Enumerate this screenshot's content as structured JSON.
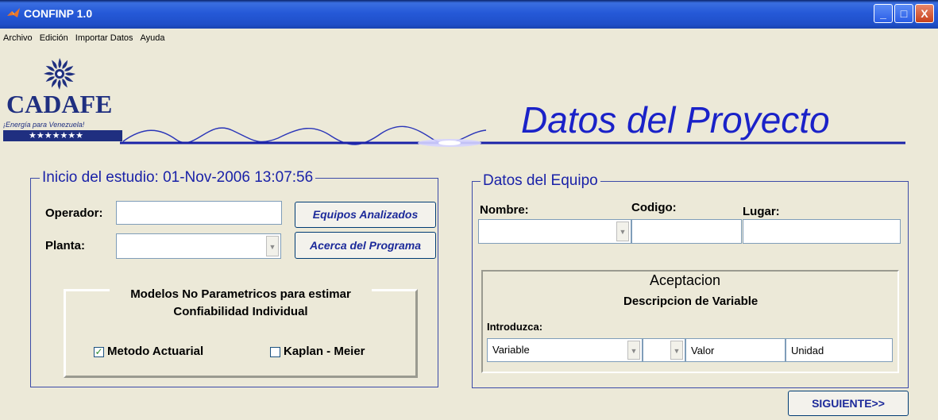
{
  "window": {
    "title": "CONFINP 1.0",
    "minimize_glyph": "_",
    "maximize_glyph": "□",
    "close_glyph": "X"
  },
  "menu": [
    "Archivo",
    "Edición",
    "Importar Datos",
    "Ayuda"
  ],
  "logo": {
    "word": "CADAFE",
    "tagline": "¡Energía para Venezuela!",
    "stars": "★★★★★★★"
  },
  "heading": "Datos del Proyecto",
  "study": {
    "title": "Inicio del estudio:  01-Nov-2006 13:07:56",
    "operador_label": "Operador:",
    "operador_value": "",
    "planta_label": "Planta:",
    "planta_value": "",
    "equipos_button": "Equipos Analizados",
    "acerca_button": "Acerca del Programa",
    "models": {
      "title_line1": "Modelos No Parametricos para estimar",
      "title_line2": "Confiabilidad Individual",
      "option1": "Metodo Actuarial",
      "option1_checked": true,
      "option2": "Kaplan - Meier",
      "option2_checked": false
    }
  },
  "equipo": {
    "title": "Datos del Equipo",
    "nombre_label": "Nombre:",
    "codigo_label": "Codigo:",
    "lugar_label": "Lugar:",
    "nombre_value": "",
    "codigo_value": "",
    "lugar_value": "",
    "aceptacion": {
      "title": "Aceptacion",
      "subtitle": "Descripcion de Variable",
      "introduzca_label": "Introduzca:",
      "variable_value": "Variable",
      "second_select_value": "",
      "valor_value": "Valor",
      "unidad_value": "Unidad"
    }
  },
  "siguiente_button": "SIGUIENTE>>",
  "colors": {
    "titlebar": "#2559d8",
    "background": "#ece9d8",
    "heading": "#1a22c8",
    "group_border": "#3b4aa8"
  }
}
